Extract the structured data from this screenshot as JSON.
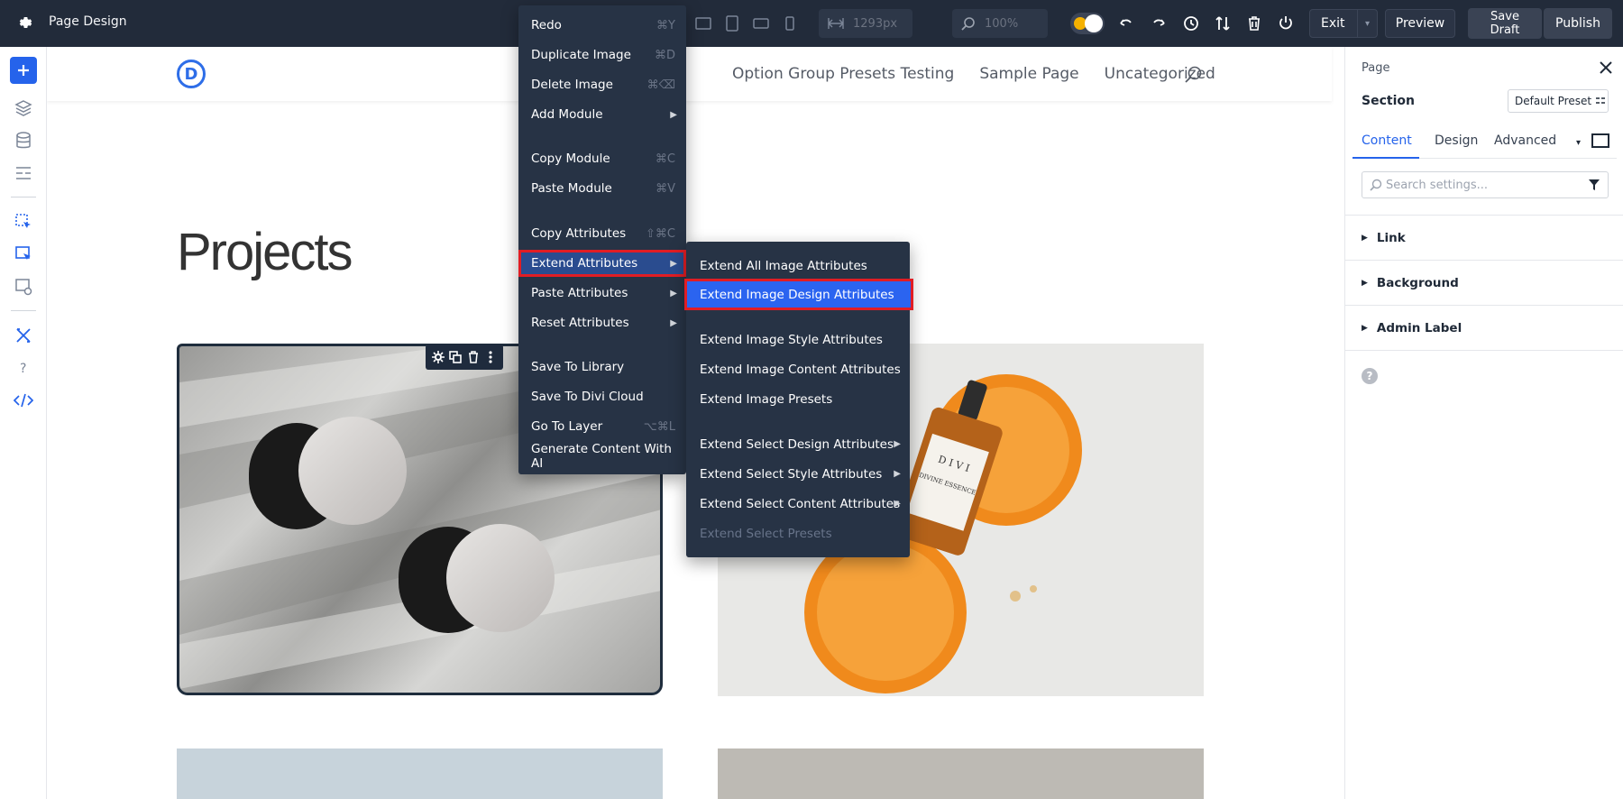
{
  "topbar": {
    "title": "Page Design",
    "width_field": "1293px",
    "zoom_field": "100%",
    "exit_label": "Exit",
    "preview_label": "Preview",
    "save_draft_label": "Save\nDraft",
    "publish_label": "Publish"
  },
  "site": {
    "logo_letter": "D",
    "nav": [
      "Option Group Presets Testing",
      "Sample Page",
      "Uncategorized"
    ],
    "heading": "Projects",
    "product_label_brand": "D I V I",
    "product_label_name": "DIVINE ESSENCE"
  },
  "context_menu": {
    "items": [
      {
        "label": "Redo",
        "shortcut": "⌘Y"
      },
      {
        "label": "Duplicate Image",
        "shortcut": "⌘D"
      },
      {
        "label": "Delete Image",
        "shortcut": "⌘⌫"
      },
      {
        "label": "Add Module",
        "arrow": "▶"
      },
      {
        "label": "Copy Module",
        "shortcut": "⌘C"
      },
      {
        "label": "Paste Module",
        "shortcut": "⌘V"
      },
      {
        "label": "Copy Attributes",
        "shortcut": "⇧⌘C"
      },
      {
        "label": "Extend Attributes",
        "arrow": "▶"
      },
      {
        "label": "Paste Attributes",
        "arrow": "▶"
      },
      {
        "label": "Reset Attributes",
        "arrow": "▶"
      },
      {
        "label": "Save To Library"
      },
      {
        "label": "Save To Divi Cloud"
      },
      {
        "label": "Go To Layer",
        "shortcut": "⌥⌘L"
      },
      {
        "label": "Generate Content With AI"
      }
    ]
  },
  "submenu": {
    "items": [
      {
        "label": "Extend All Image Attributes"
      },
      {
        "label": "Extend Image Design Attributes"
      },
      {
        "label": "Extend Image Style Attributes"
      },
      {
        "label": "Extend Image Content Attributes"
      },
      {
        "label": "Extend Image Presets"
      },
      {
        "label": "Extend Select Design Attributes",
        "arrow": "▶"
      },
      {
        "label": "Extend Select Style Attributes",
        "arrow": "▶"
      },
      {
        "label": "Extend Select Content Attributes",
        "arrow": "▶"
      },
      {
        "label": "Extend Select Presets"
      }
    ]
  },
  "panel": {
    "breadcrumb": "Page",
    "section_label": "Section",
    "preset_label": "Default Preset",
    "tabs": [
      "Content",
      "Design",
      "Advanced"
    ],
    "search_placeholder": "Search settings...",
    "groups": [
      "Link",
      "Background",
      "Admin Label"
    ],
    "help": "?"
  },
  "colors": {
    "topbar_bg": "#222b3a",
    "accent_blue": "#2563eb",
    "highlight_red": "#e11d24",
    "menu_bg": "#273345"
  }
}
